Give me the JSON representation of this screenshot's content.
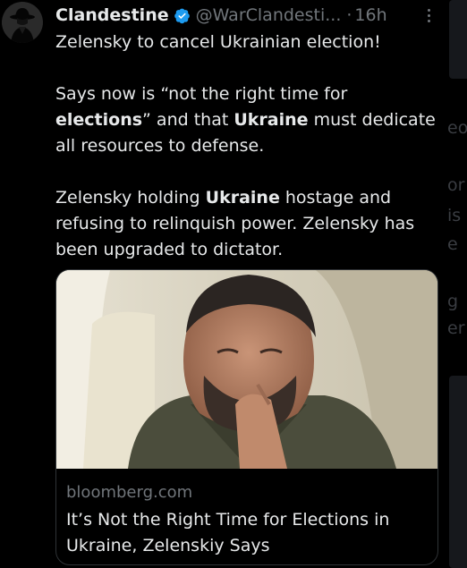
{
  "tweet": {
    "author_name": "Clandestine",
    "author_handle": "@WarClandesti...",
    "separator": "·",
    "time": "16h",
    "verified_color": "#1d9bf0",
    "line1": "Zelensky to cancel Ukrainian election!",
    "p2_a": "Says now is “not the right time for ",
    "p2_b": "elections",
    "p2_c": "” and that ",
    "p2_d": "Ukraine",
    "p2_e": " must dedicate all resources to defense.",
    "p3_a": "Zelensky holding ",
    "p3_b": "Ukraine",
    "p3_c": " hostage and refusing to relinquish power. Zelensky has been upgraded to dictator."
  },
  "card": {
    "domain": "bloomberg.com",
    "title": "It’s Not the Right Time for Elections in Ukraine, Zelenskiy Says"
  },
  "side_fragments": [
    "eo",
    "or",
    "is",
    "e",
    "g",
    "er"
  ]
}
